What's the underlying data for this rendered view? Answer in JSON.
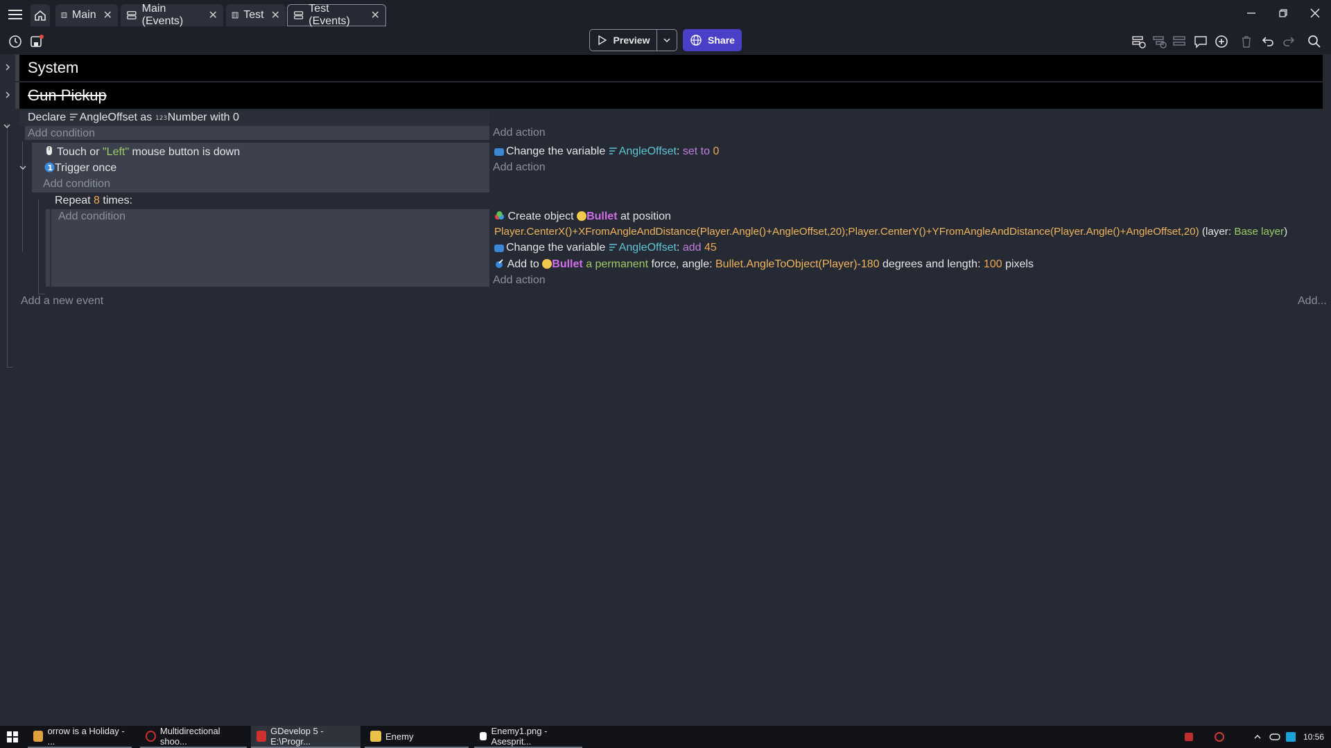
{
  "tabs": [
    {
      "label": "Main",
      "icon": "scene-icon"
    },
    {
      "label": "Main (Events)",
      "icon": "events-icon"
    },
    {
      "label": "Test",
      "icon": "scene-icon"
    },
    {
      "label": "Test (Events)",
      "icon": "events-icon",
      "active": true
    }
  ],
  "toolbar": {
    "preview_label": "Preview",
    "share_label": "Share"
  },
  "events": {
    "group_system": "System",
    "group_gun_pickup": "Gun Pickup",
    "declare": {
      "prefix": "Declare",
      "var": "AngleOffset",
      "as": "as",
      "type": "Number",
      "with": "with 0"
    },
    "add_condition": "Add condition",
    "add_action": "Add action",
    "cond1": {
      "prefix": "Touch or",
      "str": "\"Left\"",
      "suffix": "mouse button is down"
    },
    "cond2": "Trigger once",
    "act1": {
      "text": "Change the variable",
      "var": "AngleOffset",
      "op": "set to",
      "value": "0"
    },
    "repeat": {
      "prefix": "Repeat",
      "count": "8",
      "suffix": "times:"
    },
    "act2": {
      "prefix": "Create object",
      "obj": "Bullet",
      "mid": "at position",
      "expr": "Player.CenterX()+XFromAngleAndDistance(Player.Angle()+AngleOffset,20);Player.CenterY()+YFromAngleAndDistance(Player.Angle()+AngleOffset,20)",
      "layer_prefix": "(layer:",
      "layer": "Base layer",
      "layer_suffix": ")"
    },
    "act3": {
      "text": "Change the variable",
      "var": "AngleOffset",
      "op": "add",
      "value": "45"
    },
    "act4": {
      "prefix": "Add to",
      "obj": "Bullet",
      "force": "a permanent",
      "mid": "force, angle:",
      "angle": "Bullet.AngleToObject(Player)-180",
      "mid2": "degrees and length:",
      "length": "100",
      "suffix": "pixels"
    },
    "add_event": "Add a new event",
    "add_more": "Add..."
  },
  "taskbar": {
    "items": [
      {
        "label": "orrow is a Holiday - ...",
        "color": "#e0a040"
      },
      {
        "label": "Multidirectional shoo...",
        "color": "#d0302a"
      },
      {
        "label": "GDevelop 5 - E:\\Progr...",
        "color": "#d03030",
        "active": true
      },
      {
        "label": "Enemy",
        "color": "#e8c24a"
      },
      {
        "label": "Enemy1.png - Asesprit...",
        "color": "#ffffff"
      }
    ],
    "time": "10:56"
  },
  "colors": {
    "bg": "#262a34",
    "tabbar": "#1d2029",
    "accent": "#4a3fc7",
    "cond_bg": "#3c414d"
  }
}
